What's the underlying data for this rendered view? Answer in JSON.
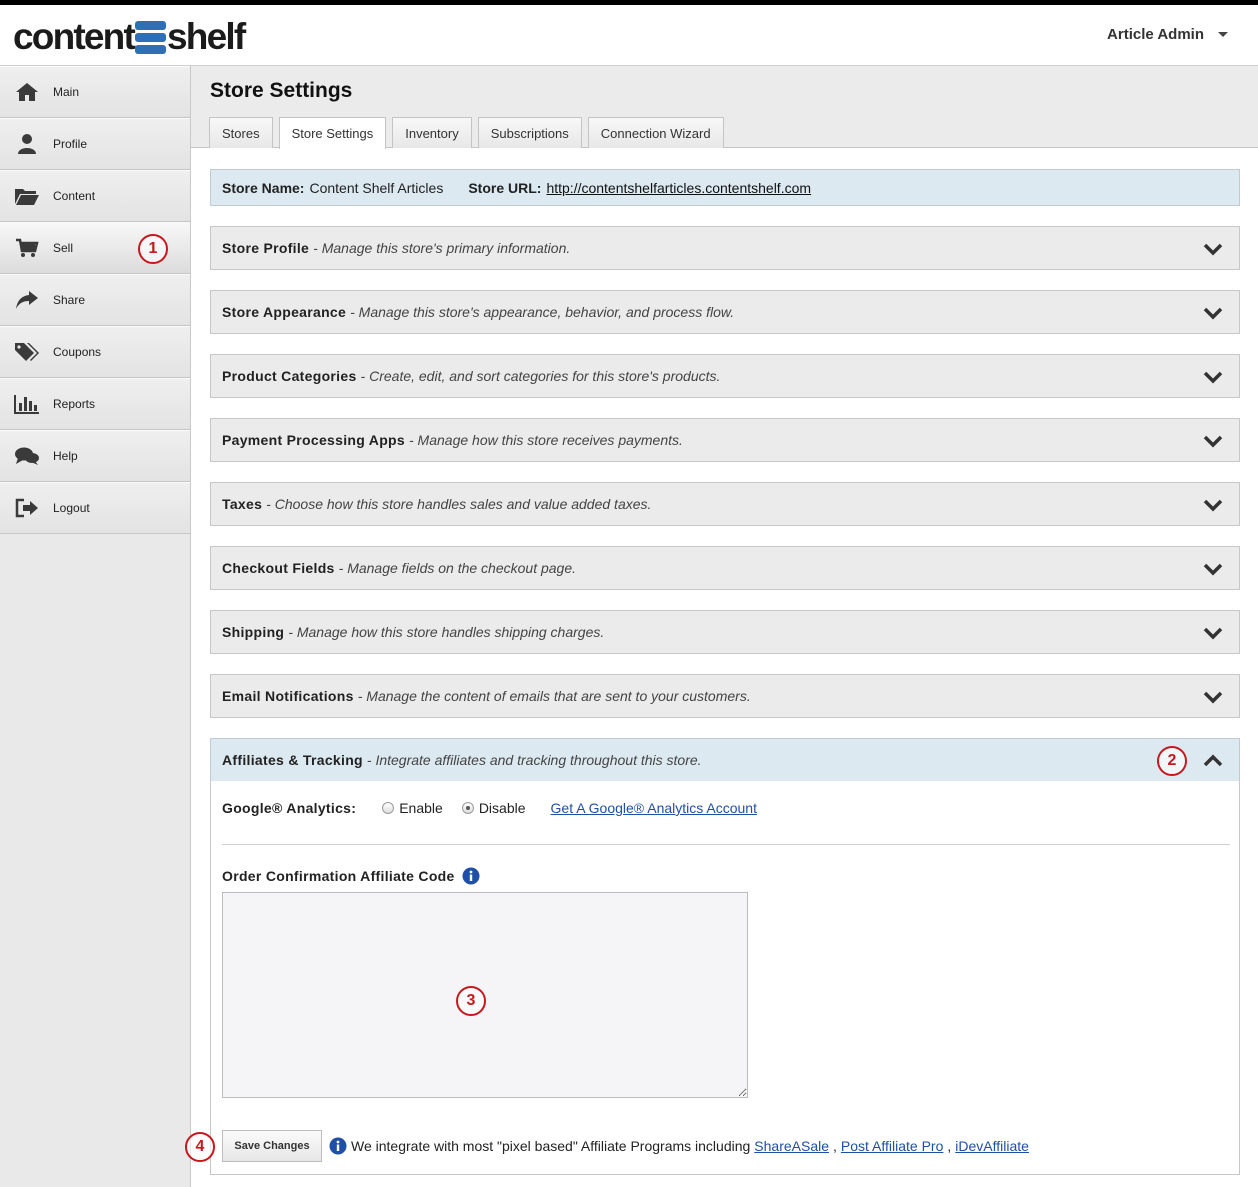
{
  "header": {
    "logo_left": "content",
    "logo_right": "shelf",
    "user_label": "Article Admin"
  },
  "sidebar": {
    "items": [
      {
        "label": "Main",
        "icon": "home-icon"
      },
      {
        "label": "Profile",
        "icon": "user-icon"
      },
      {
        "label": "Content",
        "icon": "folder-icon"
      },
      {
        "label": "Sell",
        "icon": "cart-icon"
      },
      {
        "label": "Share",
        "icon": "share-icon"
      },
      {
        "label": "Coupons",
        "icon": "tags-icon"
      },
      {
        "label": "Reports",
        "icon": "bar-chart-icon"
      },
      {
        "label": "Help",
        "icon": "chat-icon"
      },
      {
        "label": "Logout",
        "icon": "logout-icon"
      }
    ]
  },
  "page": {
    "title": "Store Settings",
    "tabs": [
      "Stores",
      "Store Settings",
      "Inventory",
      "Subscriptions",
      "Connection Wizard"
    ],
    "active_tab": "Store Settings"
  },
  "store_info": {
    "name_label": "Store Name:",
    "name_value": "Content Shelf Articles",
    "url_label": "Store URL:",
    "url_value": "http://contentshelfarticles.contentshelf.com"
  },
  "sections": [
    {
      "title": "Store Profile",
      "desc": "- Manage this store's primary information."
    },
    {
      "title": "Store Appearance",
      "desc": "- Manage this store's appearance, behavior, and process flow."
    },
    {
      "title": "Product Categories",
      "desc": "- Create, edit, and sort categories for this store's products."
    },
    {
      "title": "Payment Processing Apps",
      "desc": "- Manage how this store receives payments."
    },
    {
      "title": "Taxes",
      "desc": "- Choose how this store handles sales and value added taxes."
    },
    {
      "title": "Checkout Fields",
      "desc": "- Manage fields on the checkout page."
    },
    {
      "title": "Shipping",
      "desc": "- Manage how this store handles shipping charges."
    },
    {
      "title": "Email Notifications",
      "desc": "- Manage the content of emails that are sent to your customers."
    },
    {
      "title": "Affiliates & Tracking",
      "desc": "- Integrate affiliates and tracking throughout this store."
    }
  ],
  "affiliates": {
    "ga_label": "Google® Analytics:",
    "enable_label": "Enable",
    "disable_label": "Disable",
    "selected": "Disable",
    "ga_link": "Get A Google® Analytics Account",
    "code_label": "Order Confirmation Affiliate Code",
    "code_value": "",
    "save_label": "Save Changes",
    "integrate_text": "We integrate with most \"pixel based\" Affiliate Programs including",
    "programs": [
      "ShareASale",
      "Post Affiliate Pro",
      "iDevAffiliate"
    ]
  },
  "callouts": [
    "1",
    "2",
    "3",
    "4"
  ],
  "colors": {
    "accent_blue_bg": "#dce9f0",
    "logo_blue": "#2f6fb6",
    "callout_red": "#c8171d",
    "link_blue": "#1f4fa7"
  }
}
